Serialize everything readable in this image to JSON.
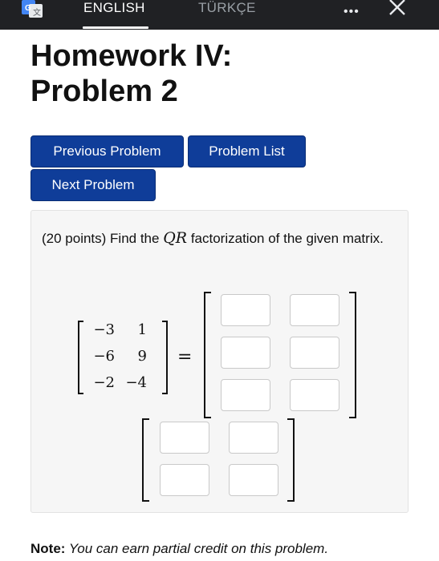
{
  "translate_bar": {
    "languages": [
      "ENGLISH",
      "TÜRKÇE"
    ],
    "more_label": "•••"
  },
  "header": {
    "title_line1": "Homework IV:",
    "title_line2": "Problem 2"
  },
  "nav": {
    "previous": "Previous Problem",
    "list": "Problem List",
    "next": "Next Problem"
  },
  "problem": {
    "prompt_before": "(20 points) Find the ",
    "prompt_math": "QR",
    "prompt_after": " factorization of the given matrix.",
    "matrix": [
      [
        "−3",
        "1"
      ],
      [
        "−6",
        "9"
      ],
      [
        "−2",
        "−4"
      ]
    ],
    "equals": "=",
    "q_answers": [
      [
        "",
        ""
      ],
      [
        "",
        ""
      ],
      [
        "",
        ""
      ]
    ],
    "r_answers": [
      [
        "",
        ""
      ],
      [
        "",
        ""
      ]
    ]
  },
  "note": {
    "label": "Note:",
    "text": " You can earn partial credit on this problem."
  }
}
